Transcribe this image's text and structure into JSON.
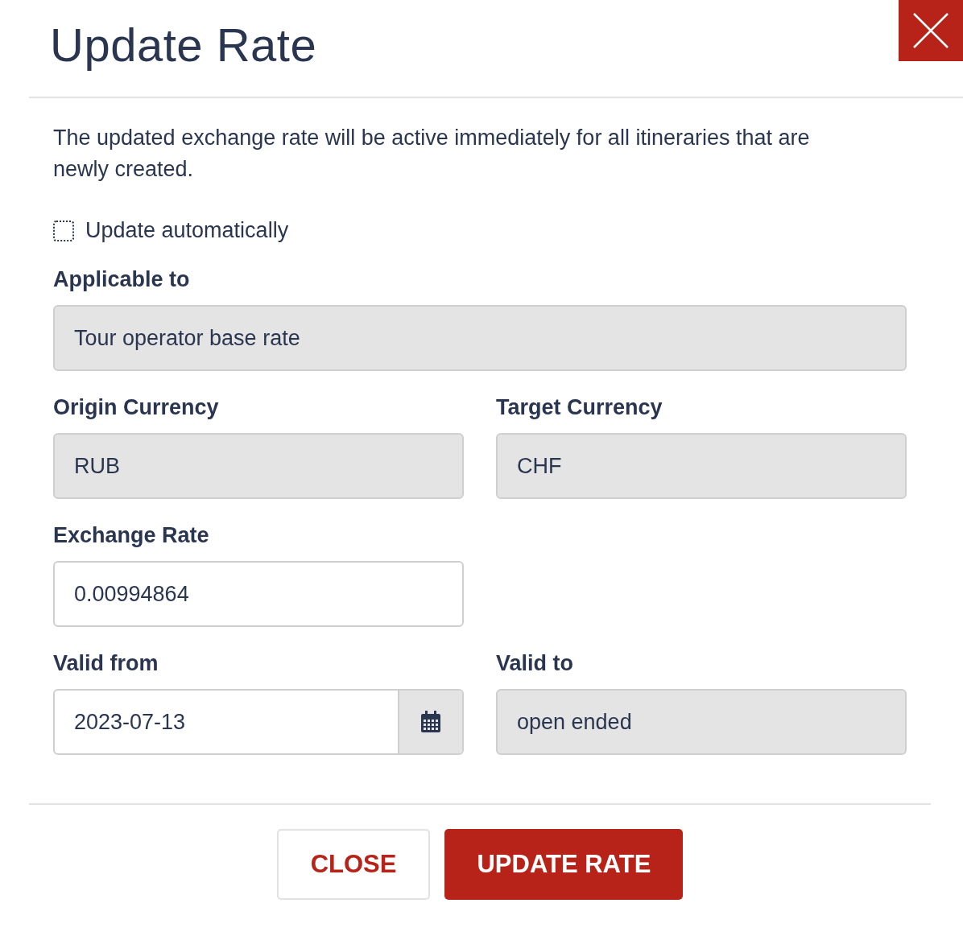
{
  "title": "Update Rate",
  "description": "The updated exchange rate will be active immediately for all itineraries that are newly created.",
  "auto_update": {
    "label": "Update automatically",
    "checked": false
  },
  "rows": [
    {
      "fields": [
        {
          "label": "Applicable to",
          "value": "Tour operator base rate",
          "disabled": true,
          "wide": true,
          "kind": "text"
        }
      ]
    },
    {
      "fields": [
        {
          "label": "Origin Currency",
          "value": "RUB",
          "disabled": true,
          "wide": false,
          "kind": "text"
        },
        {
          "label": "Target Currency",
          "value": "CHF",
          "disabled": true,
          "wide": false,
          "kind": "text"
        }
      ]
    },
    {
      "fields": [
        {
          "label": "Exchange Rate",
          "value": "0.00994864",
          "disabled": false,
          "wide": false,
          "kind": "text"
        }
      ]
    },
    {
      "fields": [
        {
          "label": "Valid from",
          "value": "2023-07-13",
          "disabled": false,
          "wide": false,
          "kind": "date"
        },
        {
          "label": "Valid to",
          "value": "open ended",
          "disabled": true,
          "wide": false,
          "kind": "text"
        }
      ]
    }
  ],
  "buttons": [
    {
      "label": "CLOSE",
      "kind": "secondary"
    },
    {
      "label": "UPDATE RATE",
      "kind": "primary"
    }
  ]
}
